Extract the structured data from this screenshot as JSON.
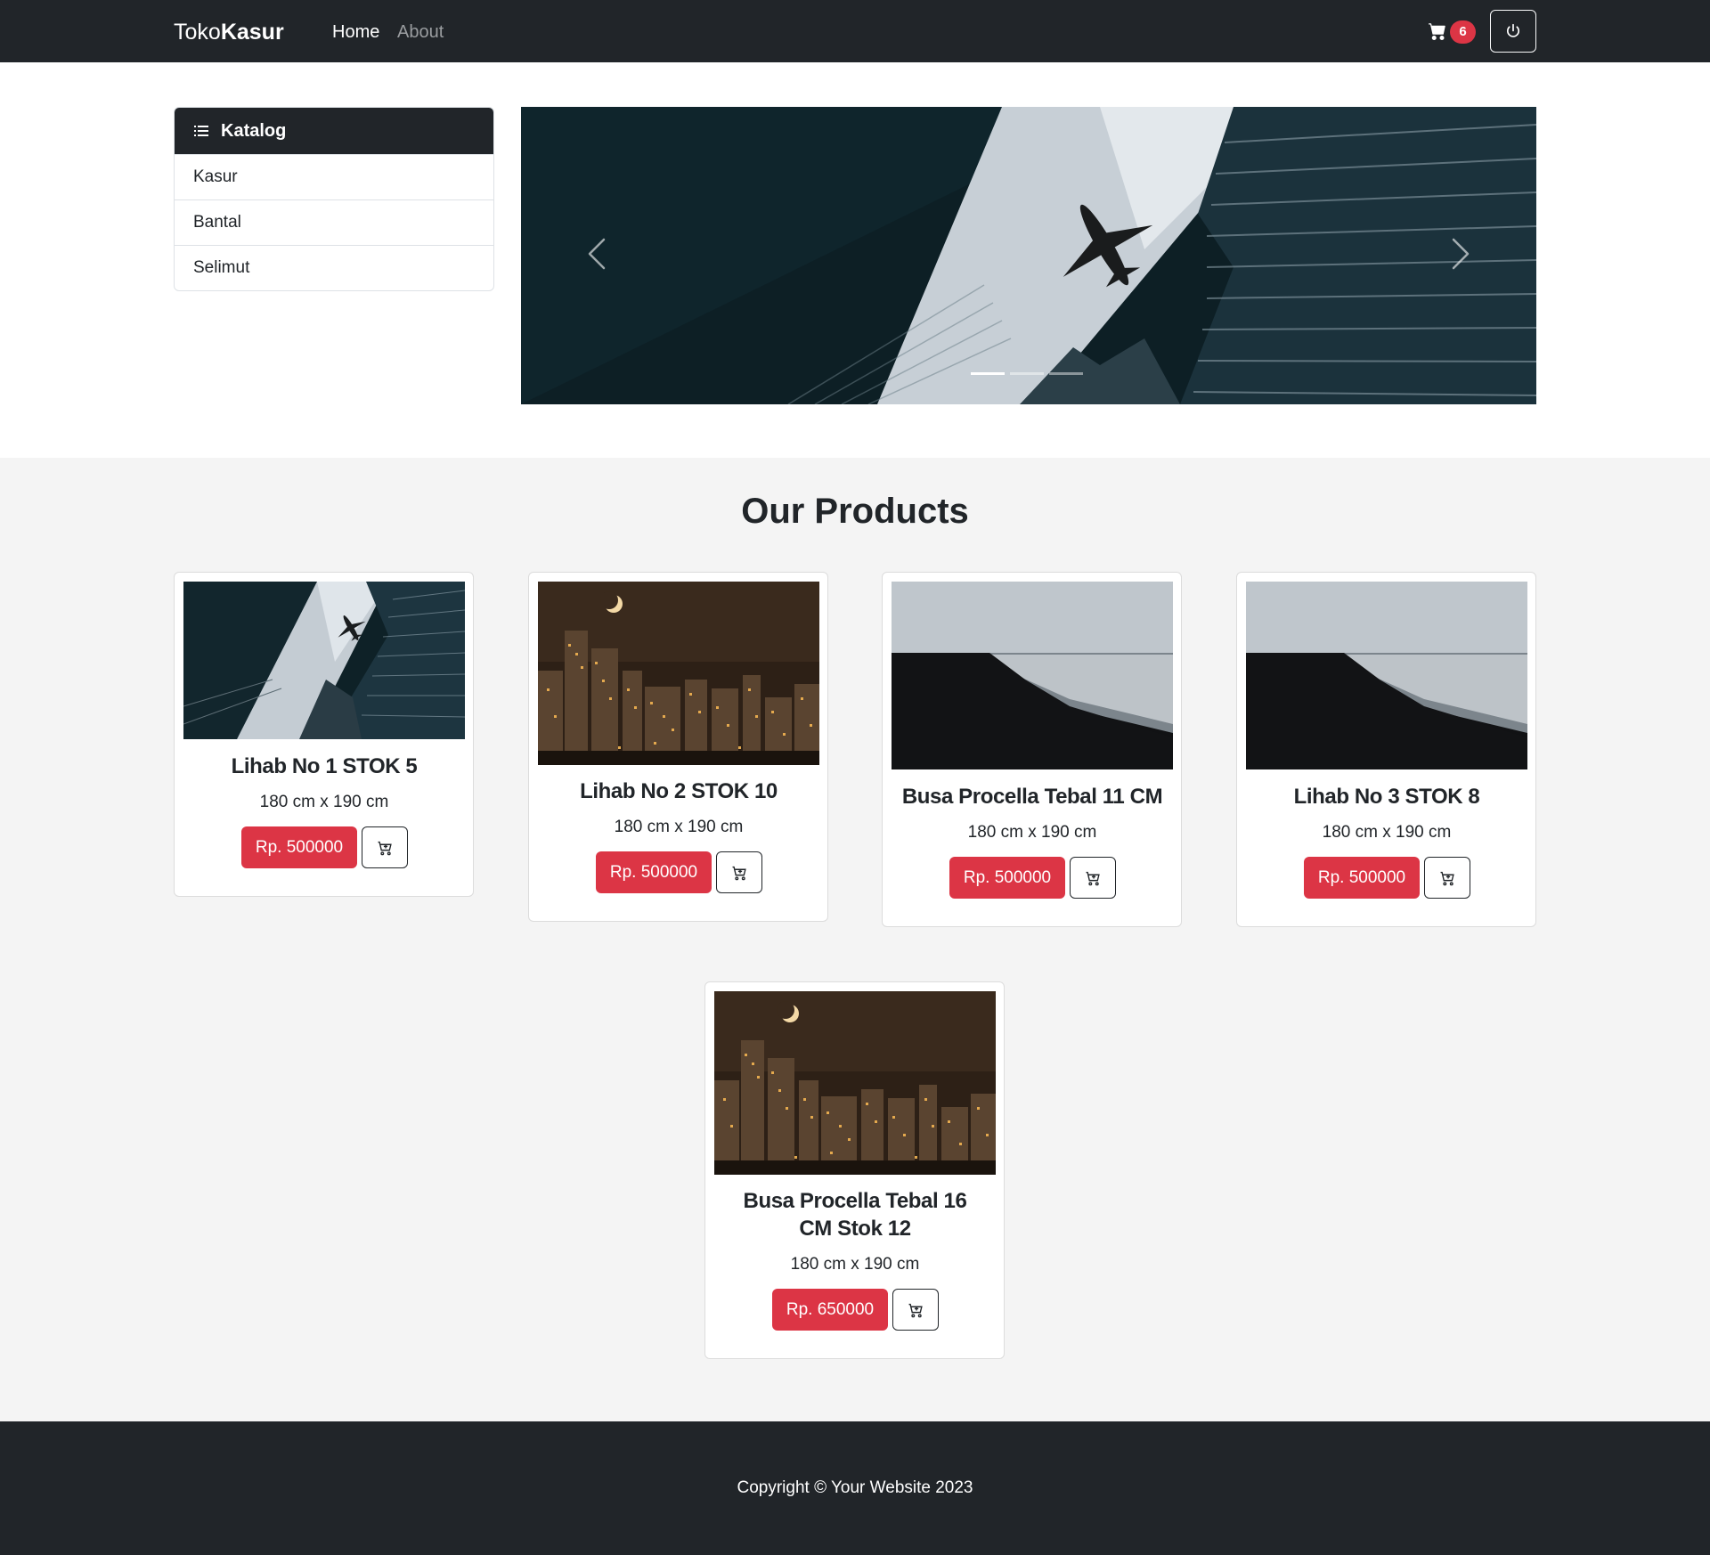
{
  "navbar": {
    "brand_prefix": "Toko",
    "brand_bold": "Kasur",
    "links": [
      {
        "label": "Home",
        "active": true
      },
      {
        "label": "About",
        "active": false
      }
    ],
    "cart_icon": "cart-icon",
    "cart_count": "6",
    "power_icon": "power-icon"
  },
  "sidebar": {
    "title": "Katalog",
    "title_icon": "list-icon",
    "items": [
      "Kasur",
      "Bantal",
      "Selimut"
    ]
  },
  "carousel": {
    "slide_count": 3,
    "active_index": 0,
    "prev_icon": "chevron-left-icon",
    "next_icon": "chevron-right-icon"
  },
  "products_section": {
    "title": "Our Products",
    "items": [
      {
        "name": "Lihab No 1 STOK 5",
        "size": "180 cm x 190 cm",
        "price": "Rp. 500000",
        "image": "skyscrapers-airplane"
      },
      {
        "name": "Lihab No 2 STOK 10",
        "size": "180 cm x 190 cm",
        "price": "Rp. 500000",
        "image": "night-city"
      },
      {
        "name": "Busa Procella Tebal 11 CM",
        "size": "180 cm x 190 cm",
        "price": "Rp. 500000",
        "image": "black-sand-beach"
      },
      {
        "name": "Lihab No 3 STOK 8",
        "size": "180 cm x 190 cm",
        "price": "Rp. 500000",
        "image": "black-sand-beach"
      },
      {
        "name": "Busa Procella Tebal 16 CM Stok 12",
        "size": "180 cm x 190 cm",
        "price": "Rp. 650000",
        "image": "night-city"
      }
    ]
  },
  "footer": {
    "copyright": "Copyright © Your Website 2023"
  },
  "colors": {
    "dark": "#212529",
    "accent_red": "#dc3545",
    "section_bg": "#f4f4f4"
  }
}
